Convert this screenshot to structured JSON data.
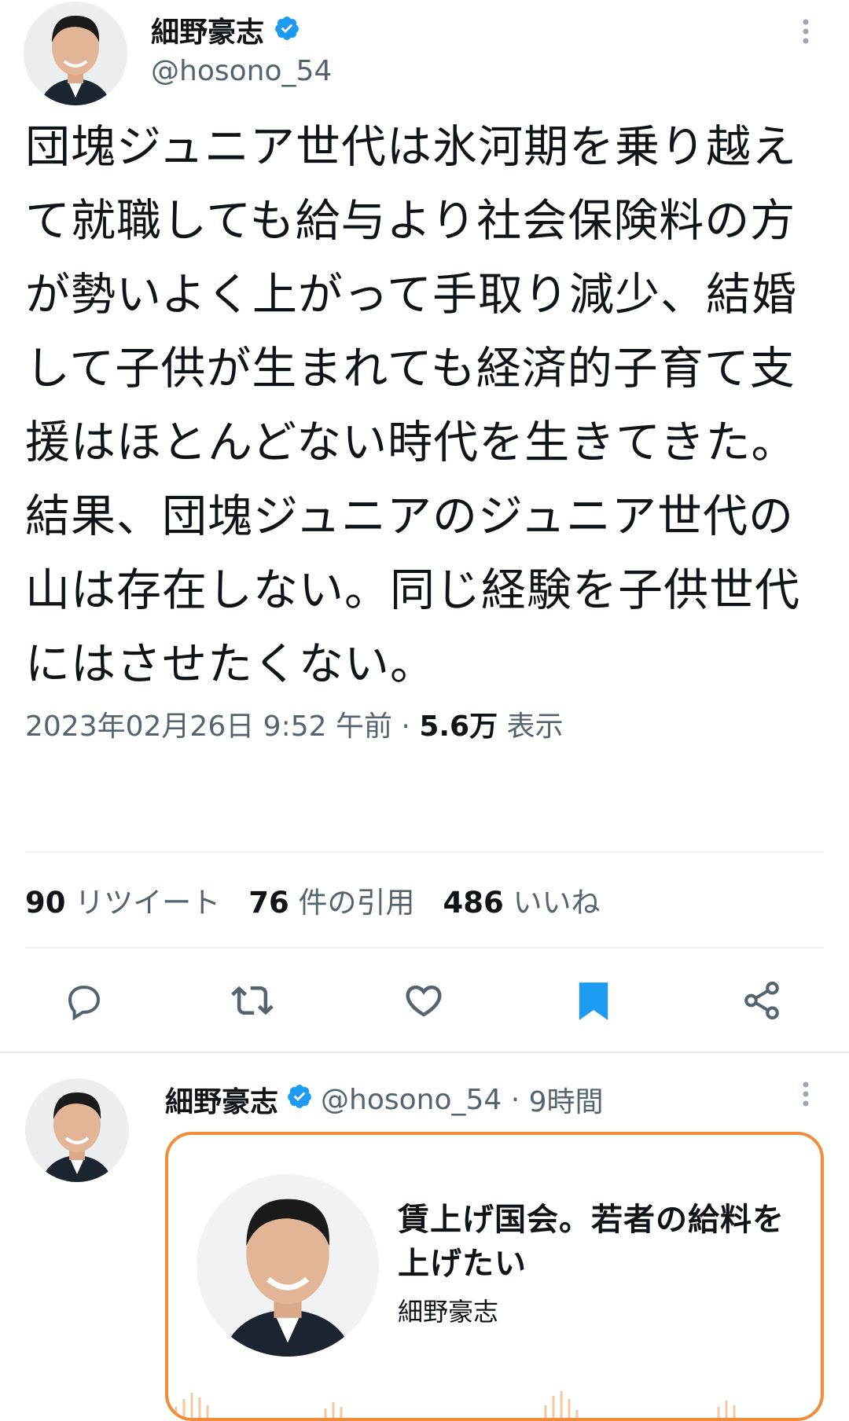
{
  "tweet": {
    "author_name": "細野豪志",
    "handle": "@hosono_54",
    "text": "団塊ジュニア世代は氷河期を乗り越えて就職しても給与より社会保険料の方が勢いよく上がって手取り減少、結婚して子供が生まれても経済的子育て支援はほとんどない時代を生きてきた。結果、団塊ジュニアのジュニア世代の山は存在しない。同じ経験を子供世代にはさせたくない。",
    "timestamp": "2023年02月26日 9:52 午前",
    "views_count": "5.6万",
    "views_label": "表示",
    "stats": {
      "retweets_count": "90",
      "retweets_label": "リツイート",
      "quotes_count": "76",
      "quotes_label": "件の引用",
      "likes_count": "486",
      "likes_label": "いいね"
    },
    "actions": [
      "reply-icon",
      "retweet-icon",
      "like-icon",
      "bookmark-icon",
      "share-icon"
    ],
    "bookmark_color": "#1d9bf0"
  },
  "reply": {
    "author_name": "細野豪志",
    "handle": "@hosono_54",
    "time_ago": "9時間",
    "card": {
      "title": "賃上げ国会。若者の給料を上げたい",
      "author": "細野豪志",
      "border_color": "#f08c3a"
    }
  },
  "colors": {
    "verified": "#1d9bf0",
    "text": "#0f1419",
    "secondary": "#536471"
  }
}
